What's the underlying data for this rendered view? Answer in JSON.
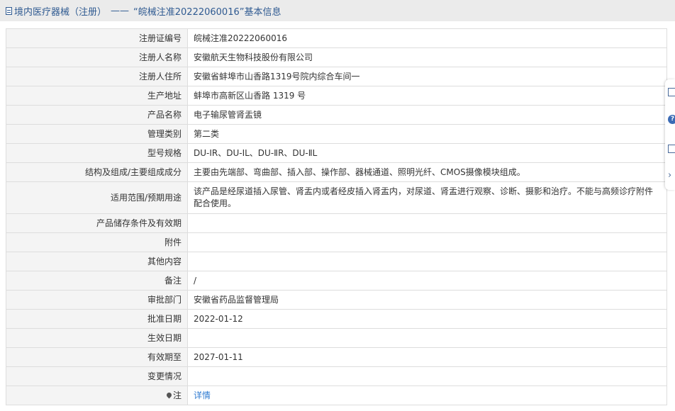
{
  "header": {
    "category": "境内医疗器械（注册）",
    "separator": "——",
    "record_title": "“皖械注准20222060016”基本信息"
  },
  "rows": [
    {
      "label": "注册证编号",
      "value": "皖械注准20222060016"
    },
    {
      "label": "注册人名称",
      "value": "安徽航天生物科技股份有限公司"
    },
    {
      "label": "注册人住所",
      "value": "安徽省蚌埠市山香路1319号院内综合车间一"
    },
    {
      "label": "生产地址",
      "value": "蚌埠市高新区山香路 1319 号"
    },
    {
      "label": "产品名称",
      "value": "电子输尿管肾盂镜"
    },
    {
      "label": "管理类别",
      "value": "第二类"
    },
    {
      "label": "型号规格",
      "value": "DU-ⅠR、DU-ⅠL、DU-ⅡR、DU-ⅡL"
    },
    {
      "label": "结构及组成/主要组成成分",
      "value": "主要由先端部、弯曲部、插入部、操作部、器械通道、照明光纤、CMOS摄像模块组成。"
    },
    {
      "label": "适用范围/预期用途",
      "value": "该产品是经尿道插入尿管、肾盂内或者经皮插入肾盂内，对尿道、肾盂进行观察、诊断、摄影和治疗。不能与高频诊疗附件配合使用。"
    },
    {
      "label": "产品储存条件及有效期",
      "value": ""
    },
    {
      "label": "附件",
      "value": ""
    },
    {
      "label": "其他内容",
      "value": ""
    },
    {
      "label": "备注",
      "value": "/"
    },
    {
      "label": "审批部门",
      "value": "安徽省药品监督管理局"
    },
    {
      "label": "批准日期",
      "value": "2022-01-12"
    },
    {
      "label": "生效日期",
      "value": ""
    },
    {
      "label": "有效期至",
      "value": "2027-01-11"
    },
    {
      "label": "变更情况",
      "value": ""
    }
  ],
  "note_row": {
    "label": "注",
    "link": "详情"
  },
  "side_toolbar": {
    "icons": [
      "edit-icon",
      "help-icon",
      "copy-icon",
      "close-icon"
    ],
    "help_glyph": "?"
  },
  "colors": {
    "title_text": "#2f5a91",
    "title_bg": "#ebebeb",
    "label_bg": "#f4f4f4",
    "border": "#dddddd",
    "link": "#2f7bd1"
  }
}
